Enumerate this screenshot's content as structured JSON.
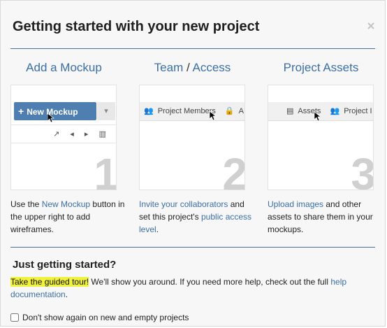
{
  "dialog": {
    "title": "Getting started with your new project",
    "close_icon": "close-icon"
  },
  "columns": [
    {
      "heading": "Add a Mockup",
      "number": "1",
      "thumb": {
        "button_label": "New Mockup",
        "button_icon": "plus-icon",
        "dropdown_icon": "chevron-down-icon",
        "toolbar_icons": [
          "arrow-icon",
          "arrow-left-icon",
          "arrow-right-icon",
          "grid-icon"
        ]
      },
      "desc": {
        "pre": "Use the ",
        "link": "New Mockup",
        "post": " button in the upper right to add wireframes."
      }
    },
    {
      "heading_a": "Team",
      "heading_sep": "/",
      "heading_b": "Access",
      "number": "2",
      "thumb": {
        "item1": "Project Members",
        "item2": "A"
      },
      "desc": {
        "link1": "Invite your collaborators",
        "mid": " and set this project's ",
        "link2": "public access level",
        "post": "."
      }
    },
    {
      "heading": "Project Assets",
      "number": "3",
      "thumb": {
        "item1": "Assets",
        "item2": "Project I"
      },
      "desc": {
        "link": "Upload images",
        "post": " and other assets to share them in your mockups."
      }
    }
  ],
  "footer": {
    "title": "Just getting started?",
    "tour": "Take the guided tour!",
    "text": " We'll show you around. If you need more help, check out the full ",
    "help_link": "help documentation",
    "period": ".",
    "checkbox_label": "Don't show again on new and empty projects",
    "checkbox_checked": false
  }
}
